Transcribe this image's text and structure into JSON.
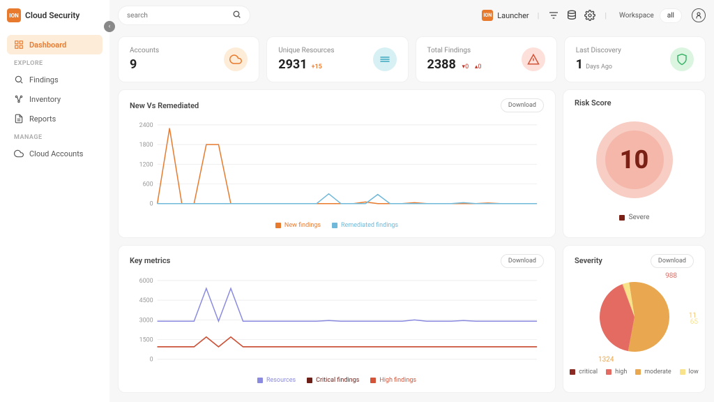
{
  "brand": {
    "badge": "ION",
    "name": "Cloud Security"
  },
  "sidebar": {
    "items": [
      {
        "label": "Dashboard",
        "icon": "dashboard-icon"
      },
      {
        "label": "Findings",
        "icon": "findings-icon"
      },
      {
        "label": "Inventory",
        "icon": "inventory-icon"
      },
      {
        "label": "Reports",
        "icon": "reports-icon"
      },
      {
        "label": "Cloud Accounts",
        "icon": "cloud-icon"
      }
    ],
    "sections": {
      "explore": "EXPLORE",
      "manage": "MANAGE"
    }
  },
  "topbar": {
    "search_placeholder": "search",
    "launcher_badge": "ION",
    "launcher_label": "Launcher",
    "workspace_label": "Workspace",
    "workspace_value": "all"
  },
  "kpis": {
    "accounts": {
      "label": "Accounts",
      "value": "9"
    },
    "resources": {
      "label": "Unique Resources",
      "value": "2931",
      "delta": "+15"
    },
    "findings": {
      "label": "Total Findings",
      "value": "2388",
      "down": "0",
      "up": "0"
    },
    "discovery": {
      "label": "Last Discovery",
      "value": "1",
      "unit": "Days  Ago"
    }
  },
  "buttons": {
    "download": "Download"
  },
  "new_vs_remediated": {
    "title": "New Vs Remediated",
    "legend": {
      "new": "New findings",
      "remediated": "Remediated findings"
    }
  },
  "key_metrics": {
    "title": "Key metrics",
    "legend": {
      "resources": "Resources",
      "critical": "Critical findings",
      "high": "High findings"
    }
  },
  "risk": {
    "title": "Risk Score",
    "value": "10",
    "severity": "Severe"
  },
  "severity": {
    "title": "Severity",
    "labels": {
      "critical": "critical",
      "high": "high",
      "moderate": "moderate",
      "low": "low"
    },
    "counts": {
      "high": "988",
      "critical": "1324",
      "moderate": "11",
      "low": "65"
    }
  },
  "chart_data": [
    {
      "type": "line",
      "title": "New Vs Remediated",
      "ylim": [
        0,
        2400
      ],
      "yticks": [
        0,
        600,
        1200,
        1800,
        2400
      ],
      "series": [
        {
          "name": "New findings",
          "color": "#e87a2e",
          "values": [
            0,
            2300,
            0,
            0,
            1800,
            1800,
            0,
            0,
            0,
            0,
            0,
            0,
            0,
            0,
            0,
            0,
            0,
            50,
            0,
            0,
            0,
            30,
            0,
            0,
            0,
            0,
            0,
            20,
            0,
            0,
            0,
            0
          ]
        },
        {
          "name": "Remediated findings",
          "color": "#6fb8d9",
          "values": [
            0,
            0,
            0,
            0,
            0,
            0,
            0,
            0,
            0,
            0,
            0,
            0,
            0,
            0,
            300,
            0,
            0,
            0,
            280,
            0,
            0,
            0,
            0,
            0,
            0,
            30,
            0,
            0,
            0,
            0,
            0,
            0
          ]
        }
      ]
    },
    {
      "type": "line",
      "title": "Key metrics",
      "ylim": [
        0,
        6000
      ],
      "yticks": [
        0,
        1500,
        3000,
        4500,
        6000
      ],
      "series": [
        {
          "name": "Resources",
          "color": "#8a8ae0",
          "values": [
            2900,
            2900,
            2900,
            2900,
            5400,
            2900,
            5400,
            2900,
            2900,
            2900,
            2900,
            2900,
            2900,
            2900,
            2950,
            2900,
            2900,
            2900,
            2900,
            2900,
            2900,
            3000,
            2900,
            2900,
            2900,
            2950,
            2900,
            2900,
            2900,
            2900,
            2900,
            2900
          ]
        },
        {
          "name": "Critical findings",
          "color": "#6d1e16",
          "values": [
            950,
            950,
            950,
            950,
            1700,
            950,
            1700,
            950,
            950,
            950,
            950,
            950,
            950,
            950,
            950,
            950,
            950,
            950,
            950,
            950,
            950,
            950,
            950,
            950,
            950,
            950,
            950,
            950,
            950,
            950,
            950,
            950
          ]
        },
        {
          "name": "High findings",
          "color": "#d35438",
          "values": [
            950,
            950,
            950,
            950,
            1700,
            950,
            1700,
            950,
            950,
            950,
            950,
            950,
            950,
            950,
            950,
            950,
            950,
            950,
            950,
            950,
            950,
            950,
            950,
            950,
            950,
            950,
            950,
            950,
            950,
            950,
            950,
            950
          ]
        }
      ]
    },
    {
      "type": "pie",
      "title": "Severity",
      "slices": [
        {
          "name": "critical",
          "value": 1324,
          "color": "#e9a74f"
        },
        {
          "name": "high",
          "value": 988,
          "color": "#e46b62"
        },
        {
          "name": "moderate",
          "value": 11,
          "color": "#f3c97a"
        },
        {
          "name": "low",
          "value": 65,
          "color": "#f8e38a"
        }
      ]
    }
  ]
}
